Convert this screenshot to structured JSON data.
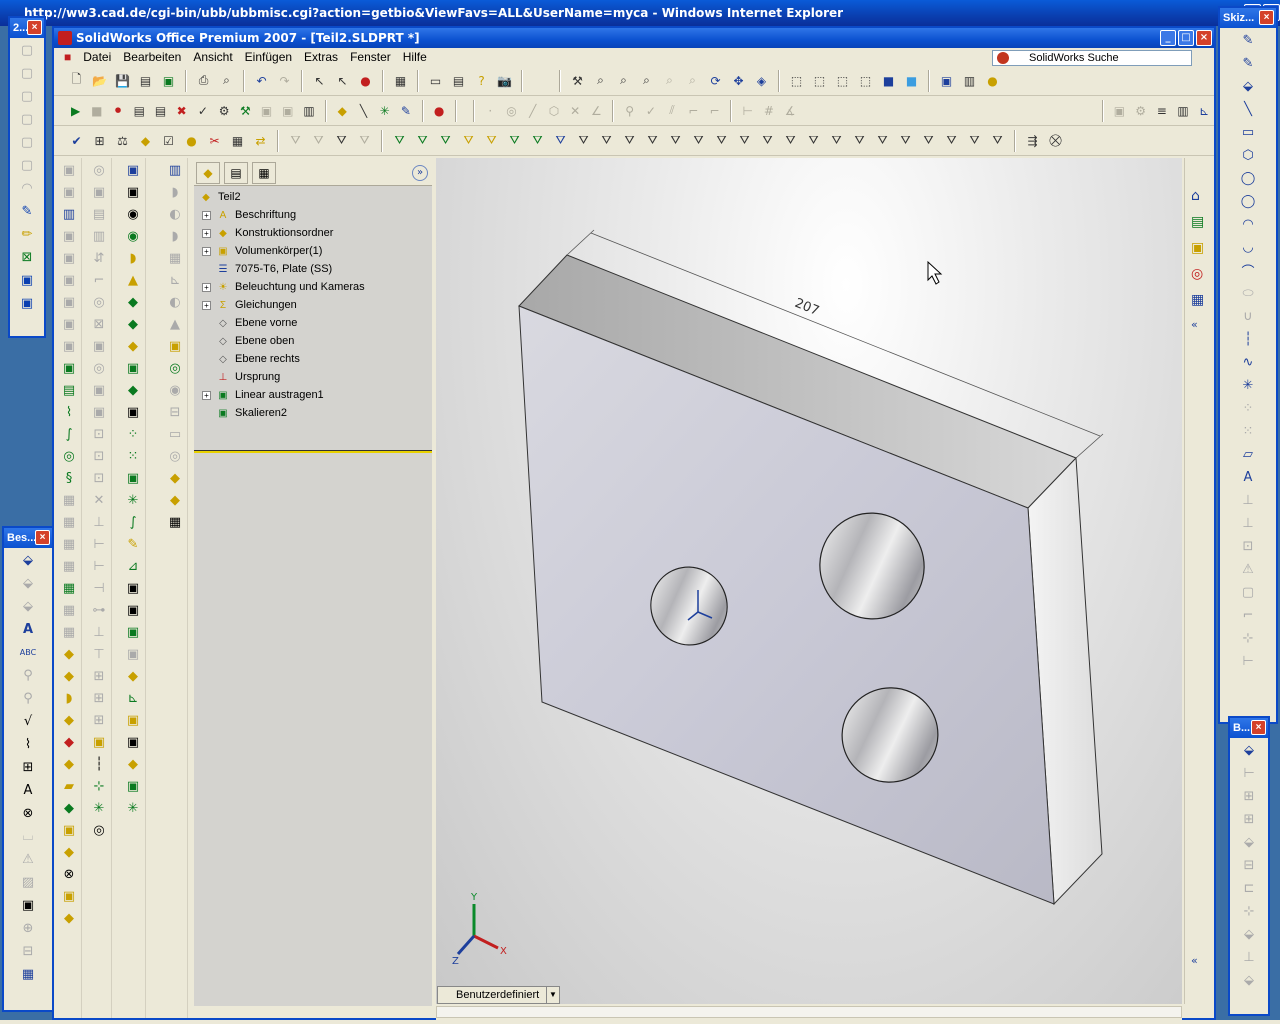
{
  "ie": {
    "title": "http://ww3.cad.de/cgi-bin/ubb/ubbmisc.cgi?action=getbio&ViewFavs=ALL&UserName=myca - Windows Internet Explorer"
  },
  "sw": {
    "title": "SolidWorks Office Premium 2007 - [Teil2.SLDPRT *]"
  },
  "menu": [
    "Datei",
    "Bearbeiten",
    "Ansicht",
    "Einfügen",
    "Extras",
    "Fenster",
    "Hilfe"
  ],
  "search": {
    "placeholder": "SolidWorks Suche"
  },
  "tree": {
    "root": "Teil2",
    "nodes": [
      {
        "label": "Beschriftung",
        "expand": "+",
        "icon": "annotation-icon"
      },
      {
        "label": "Konstruktionsordner",
        "expand": "+",
        "icon": "design-folder-icon"
      },
      {
        "label": "Volumenkörper(1)",
        "expand": "+",
        "icon": "solid-bodies-icon"
      },
      {
        "label": "7075-T6, Plate (SS)",
        "expand": "",
        "icon": "material-icon"
      },
      {
        "label": "Beleuchtung und Kameras",
        "expand": "+",
        "icon": "lights-icon"
      },
      {
        "label": "Gleichungen",
        "expand": "+",
        "icon": "equations-icon"
      },
      {
        "label": "Ebene vorne",
        "expand": "",
        "icon": "plane-icon"
      },
      {
        "label": "Ebene oben",
        "expand": "",
        "icon": "plane-icon"
      },
      {
        "label": "Ebene rechts",
        "expand": "",
        "icon": "plane-icon"
      },
      {
        "label": "Ursprung",
        "expand": "",
        "icon": "origin-icon"
      },
      {
        "label": "Linear austragen1",
        "expand": "+",
        "icon": "extrude-icon"
      },
      {
        "label": "Skalieren2",
        "expand": "",
        "icon": "scale-icon"
      }
    ]
  },
  "model": {
    "dimension": "207"
  },
  "config": {
    "label": "Benutzerdefiniert"
  },
  "palettes": {
    "left_top": "2...",
    "left_bottom": "Bes...",
    "right_top": "Skiz...",
    "right_bottom": "B..."
  },
  "triad": {
    "x": "X",
    "y": "Y",
    "z": "Z"
  }
}
